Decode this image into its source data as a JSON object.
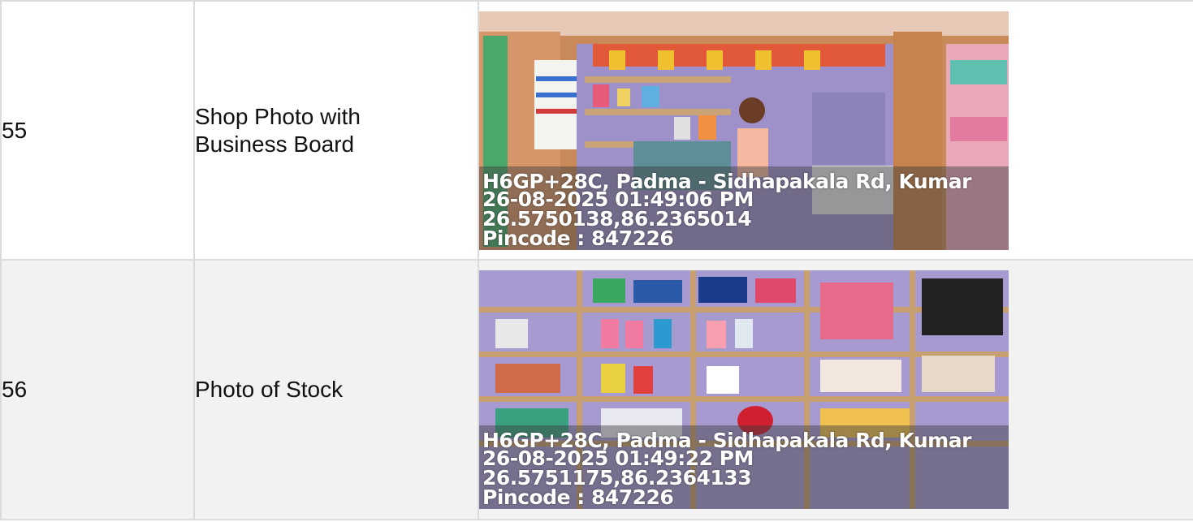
{
  "rows": [
    {
      "sn": "55",
      "title_line1": "Shop Photo with",
      "title_line2": "Business Board",
      "stamp": {
        "address": "H6GP+28C, Padma - Sidhapakala Rd, Kumar",
        "datetime": "26-08-2025 01:49:06 PM",
        "coords": "26.5750138,86.2365014",
        "pincode": "Pincode : 847226"
      }
    },
    {
      "sn": "56",
      "title_line1": "Photo of Stock",
      "stamp": {
        "address": "H6GP+28C, Padma - Sidhapakala Rd, Kumar",
        "datetime": "26-08-2025 01:49:22 PM",
        "coords": "26.5751175,86.2364133",
        "pincode": "Pincode : 847226"
      }
    }
  ]
}
